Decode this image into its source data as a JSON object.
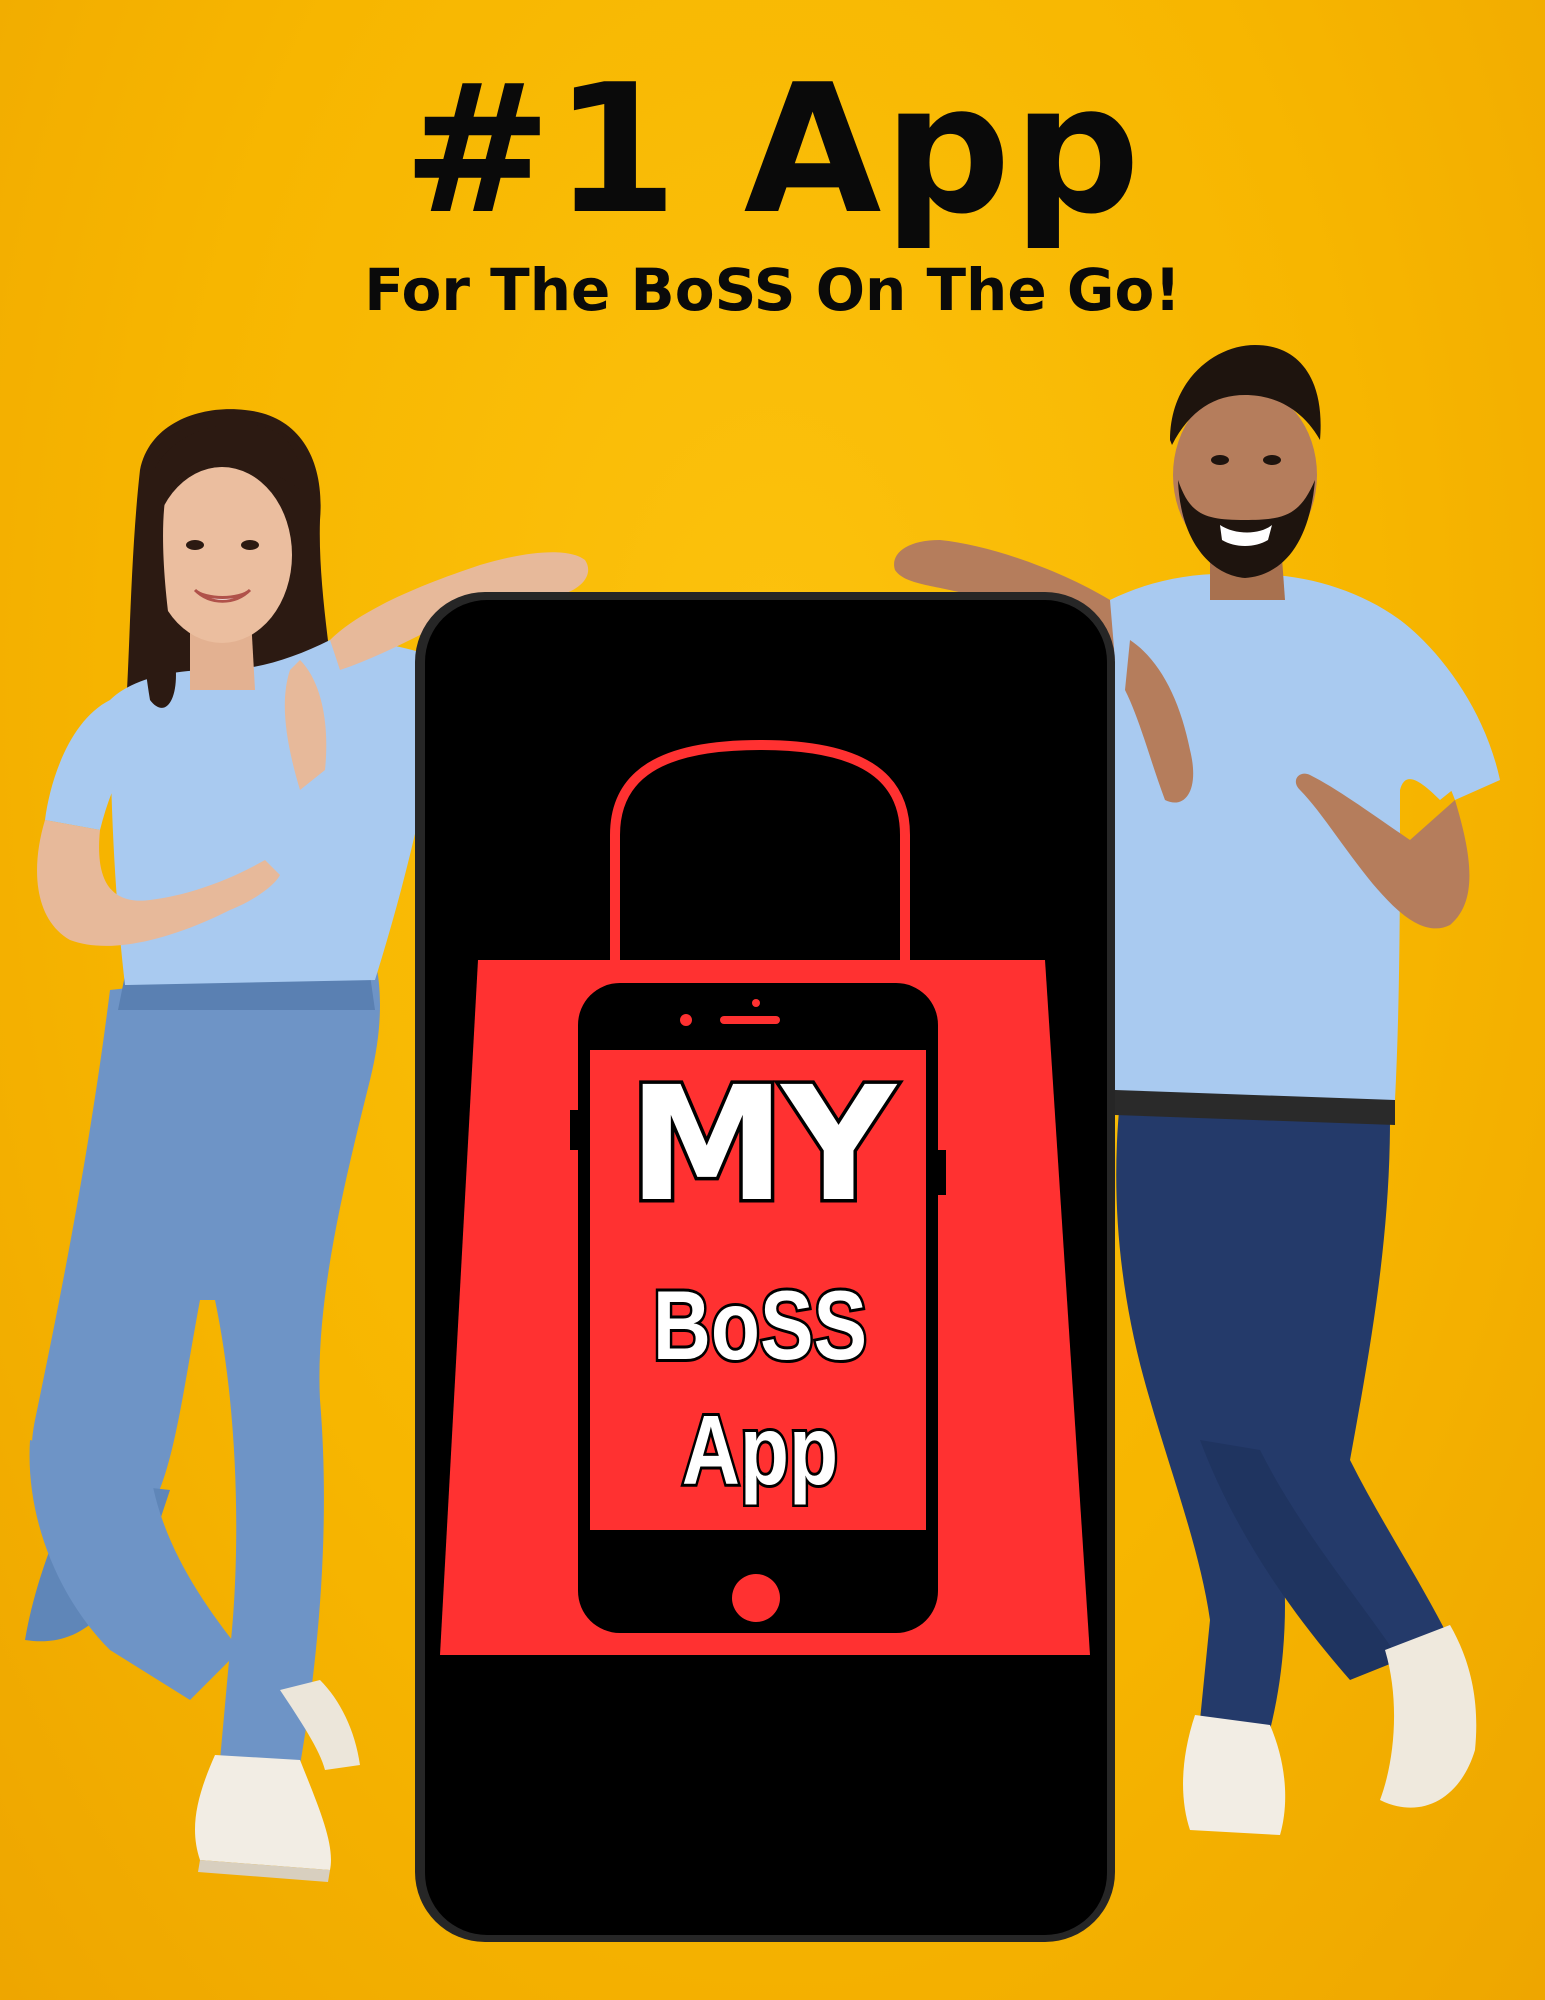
{
  "headline": "#1 App",
  "tagline": "For The BoSS On The Go!",
  "logo": {
    "line1": "MY",
    "line2": "BoSS",
    "line3": "App"
  },
  "colors": {
    "background": "#f7b600",
    "phone": "#000000",
    "bag": "#ff3131",
    "shirt": "#a9caf0",
    "jeans": "#5f86b8",
    "dark_jeans": "#1f3460"
  }
}
